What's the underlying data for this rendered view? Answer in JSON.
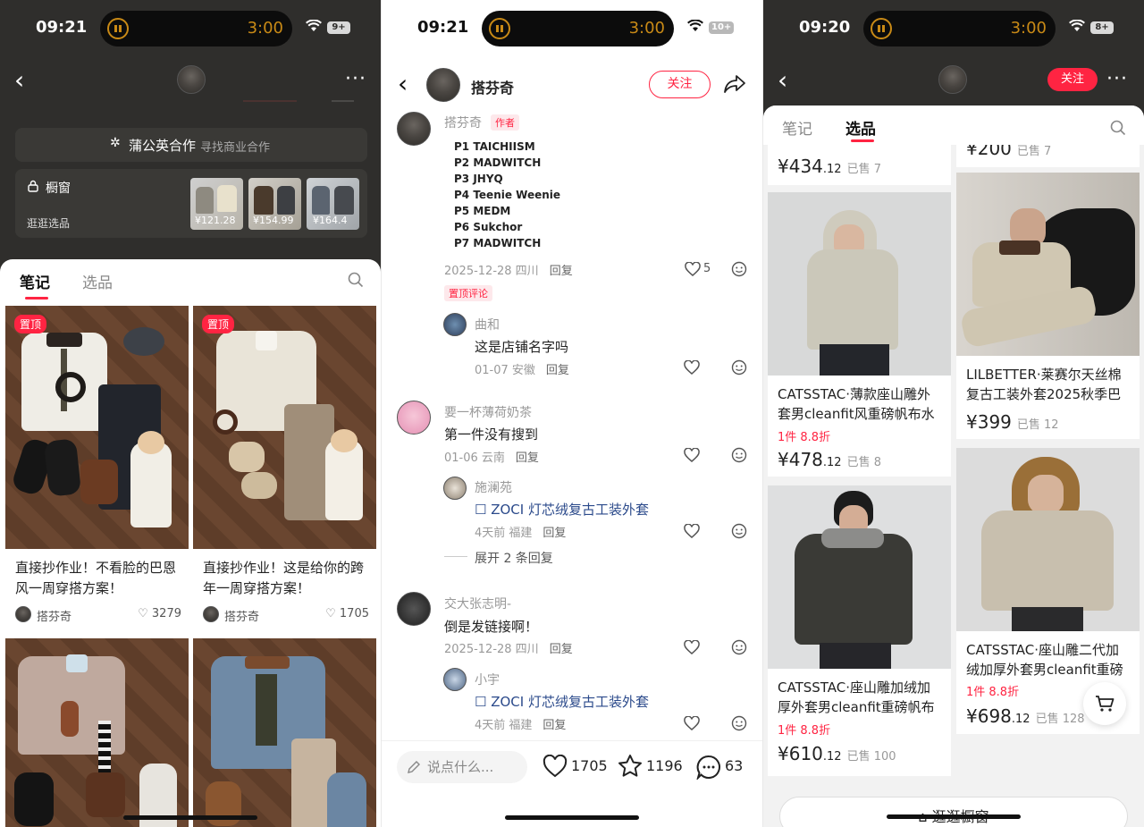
{
  "status_left": {
    "time": "09:21",
    "island_time": "3:00",
    "battery": "9+"
  },
  "status_mid": {
    "time": "09:21",
    "island_time": "3:00",
    "battery": "10+"
  },
  "status_right": {
    "time": "09:20",
    "island_time": "3:00",
    "battery": "8+"
  },
  "profile": {
    "cooperation_title": "蒲公英合作",
    "cooperation_sub": "寻找商业合作",
    "showcase_label": "橱窗",
    "browse_label": "逛逛选品",
    "thumb_prices": [
      "¥121.28",
      "¥154.99",
      "¥164.4"
    ],
    "tabs": [
      "笔记",
      "选品"
    ],
    "pin_label": "置顶",
    "notes": [
      {
        "title": "直接抄作业！不看脸的巴恩风一周穿搭方案！",
        "author": "搭芬奇",
        "likes": "3279"
      },
      {
        "title": "直接抄作业！这是给你的跨年一周穿搭方案！",
        "author": "搭芬奇",
        "likes": "1705"
      }
    ]
  },
  "comments_page": {
    "author_name": "搭芬奇",
    "follow_label": "关注",
    "main_comment": {
      "name": "搭芬奇",
      "badge": "作者",
      "lines": [
        "P1 TAICHIISM",
        "P2 MADWITCH",
        "P3 JHYQ",
        "P4 Teenie Weenie",
        "P5 MEDM",
        "P6 Sukchor",
        "P7 MADWITCH"
      ],
      "meta": "2025-12-28 四川",
      "reply": "回复",
      "likes": "5",
      "pinned_tag": "置顶评论"
    },
    "comments": [
      {
        "name": "曲和",
        "text": "这是店铺名字吗",
        "meta": "01-07 安徽",
        "reply": "回复"
      },
      {
        "name": "要一杯薄荷奶茶",
        "text": "第一件没有搜到",
        "meta": "01-06 云南",
        "reply": "回复"
      },
      {
        "name": "施澜苑",
        "text": "ZOCI 灯芯绒复古工装外套",
        "meta": "4天前 福建",
        "reply": "回复"
      },
      {
        "name": "交大张志明-",
        "text": "倒是发链接啊！",
        "meta": "2025-12-28 四川",
        "reply": "回复"
      },
      {
        "name": "小宇",
        "text": "ZOCI 灯芯绒复古工装外套",
        "meta": "4天前 福建",
        "reply": "回复"
      }
    ],
    "expand_label": "展开 2 条回复",
    "input_placeholder": "说点什么...",
    "likes": "1705",
    "stars": "1196",
    "comment_count": "63"
  },
  "shop_page": {
    "follow_label": "关注",
    "tabs": [
      "笔记",
      "选品"
    ],
    "top_left": {
      "price": "¥434",
      "decimal": ".12",
      "sold": "已售 7"
    },
    "top_right": {
      "price": "¥200",
      "sold": "已售 7"
    },
    "products": [
      {
        "title": "CATSSTAC·薄款座山雕外套男cleanfit风重磅帆布水",
        "discount": "1件 8.8折",
        "price": "¥478",
        "decimal": ".12",
        "sold": "已售 8"
      },
      {
        "title": "LILBETTER·莱赛尔天丝棉复古工装外套2025秋季巴",
        "discount": "",
        "price": "¥399",
        "decimal": "",
        "sold": "已售 12"
      },
      {
        "title": "CATSSTAC·座山雕加绒加厚外套男cleanfit重磅帆布",
        "discount": "1件 8.8折",
        "price": "¥610",
        "decimal": ".12",
        "sold": "已售 100"
      },
      {
        "title": "CATSSTAC·座山雕二代加绒加厚外套男cleanfit重磅",
        "discount": "1件 8.8折",
        "price": "¥698",
        "decimal": ".12",
        "sold": "已售 128"
      }
    ],
    "shop_button": "逛逛橱窗"
  },
  "colors": {
    "accent": "#ff2442",
    "dark_bg": "#2f2e2c",
    "link": "#2b4a8b"
  }
}
